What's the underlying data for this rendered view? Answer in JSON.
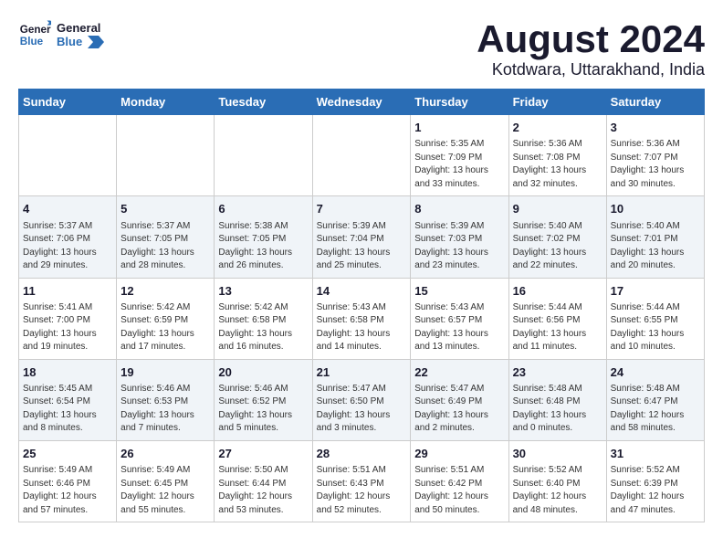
{
  "header": {
    "logo_line1": "General",
    "logo_line2": "Blue",
    "title": "August 2024",
    "subtitle": "Kotdwara, Uttarakhand, India"
  },
  "weekdays": [
    "Sunday",
    "Monday",
    "Tuesday",
    "Wednesday",
    "Thursday",
    "Friday",
    "Saturday"
  ],
  "weeks": [
    [
      {
        "day": "",
        "info": ""
      },
      {
        "day": "",
        "info": ""
      },
      {
        "day": "",
        "info": ""
      },
      {
        "day": "",
        "info": ""
      },
      {
        "day": "1",
        "info": "Sunrise: 5:35 AM\nSunset: 7:09 PM\nDaylight: 13 hours\nand 33 minutes."
      },
      {
        "day": "2",
        "info": "Sunrise: 5:36 AM\nSunset: 7:08 PM\nDaylight: 13 hours\nand 32 minutes."
      },
      {
        "day": "3",
        "info": "Sunrise: 5:36 AM\nSunset: 7:07 PM\nDaylight: 13 hours\nand 30 minutes."
      }
    ],
    [
      {
        "day": "4",
        "info": "Sunrise: 5:37 AM\nSunset: 7:06 PM\nDaylight: 13 hours\nand 29 minutes."
      },
      {
        "day": "5",
        "info": "Sunrise: 5:37 AM\nSunset: 7:05 PM\nDaylight: 13 hours\nand 28 minutes."
      },
      {
        "day": "6",
        "info": "Sunrise: 5:38 AM\nSunset: 7:05 PM\nDaylight: 13 hours\nand 26 minutes."
      },
      {
        "day": "7",
        "info": "Sunrise: 5:39 AM\nSunset: 7:04 PM\nDaylight: 13 hours\nand 25 minutes."
      },
      {
        "day": "8",
        "info": "Sunrise: 5:39 AM\nSunset: 7:03 PM\nDaylight: 13 hours\nand 23 minutes."
      },
      {
        "day": "9",
        "info": "Sunrise: 5:40 AM\nSunset: 7:02 PM\nDaylight: 13 hours\nand 22 minutes."
      },
      {
        "day": "10",
        "info": "Sunrise: 5:40 AM\nSunset: 7:01 PM\nDaylight: 13 hours\nand 20 minutes."
      }
    ],
    [
      {
        "day": "11",
        "info": "Sunrise: 5:41 AM\nSunset: 7:00 PM\nDaylight: 13 hours\nand 19 minutes."
      },
      {
        "day": "12",
        "info": "Sunrise: 5:42 AM\nSunset: 6:59 PM\nDaylight: 13 hours\nand 17 minutes."
      },
      {
        "day": "13",
        "info": "Sunrise: 5:42 AM\nSunset: 6:58 PM\nDaylight: 13 hours\nand 16 minutes."
      },
      {
        "day": "14",
        "info": "Sunrise: 5:43 AM\nSunset: 6:58 PM\nDaylight: 13 hours\nand 14 minutes."
      },
      {
        "day": "15",
        "info": "Sunrise: 5:43 AM\nSunset: 6:57 PM\nDaylight: 13 hours\nand 13 minutes."
      },
      {
        "day": "16",
        "info": "Sunrise: 5:44 AM\nSunset: 6:56 PM\nDaylight: 13 hours\nand 11 minutes."
      },
      {
        "day": "17",
        "info": "Sunrise: 5:44 AM\nSunset: 6:55 PM\nDaylight: 13 hours\nand 10 minutes."
      }
    ],
    [
      {
        "day": "18",
        "info": "Sunrise: 5:45 AM\nSunset: 6:54 PM\nDaylight: 13 hours\nand 8 minutes."
      },
      {
        "day": "19",
        "info": "Sunrise: 5:46 AM\nSunset: 6:53 PM\nDaylight: 13 hours\nand 7 minutes."
      },
      {
        "day": "20",
        "info": "Sunrise: 5:46 AM\nSunset: 6:52 PM\nDaylight: 13 hours\nand 5 minutes."
      },
      {
        "day": "21",
        "info": "Sunrise: 5:47 AM\nSunset: 6:50 PM\nDaylight: 13 hours\nand 3 minutes."
      },
      {
        "day": "22",
        "info": "Sunrise: 5:47 AM\nSunset: 6:49 PM\nDaylight: 13 hours\nand 2 minutes."
      },
      {
        "day": "23",
        "info": "Sunrise: 5:48 AM\nSunset: 6:48 PM\nDaylight: 13 hours\nand 0 minutes."
      },
      {
        "day": "24",
        "info": "Sunrise: 5:48 AM\nSunset: 6:47 PM\nDaylight: 12 hours\nand 58 minutes."
      }
    ],
    [
      {
        "day": "25",
        "info": "Sunrise: 5:49 AM\nSunset: 6:46 PM\nDaylight: 12 hours\nand 57 minutes."
      },
      {
        "day": "26",
        "info": "Sunrise: 5:49 AM\nSunset: 6:45 PM\nDaylight: 12 hours\nand 55 minutes."
      },
      {
        "day": "27",
        "info": "Sunrise: 5:50 AM\nSunset: 6:44 PM\nDaylight: 12 hours\nand 53 minutes."
      },
      {
        "day": "28",
        "info": "Sunrise: 5:51 AM\nSunset: 6:43 PM\nDaylight: 12 hours\nand 52 minutes."
      },
      {
        "day": "29",
        "info": "Sunrise: 5:51 AM\nSunset: 6:42 PM\nDaylight: 12 hours\nand 50 minutes."
      },
      {
        "day": "30",
        "info": "Sunrise: 5:52 AM\nSunset: 6:40 PM\nDaylight: 12 hours\nand 48 minutes."
      },
      {
        "day": "31",
        "info": "Sunrise: 5:52 AM\nSunset: 6:39 PM\nDaylight: 12 hours\nand 47 minutes."
      }
    ]
  ]
}
